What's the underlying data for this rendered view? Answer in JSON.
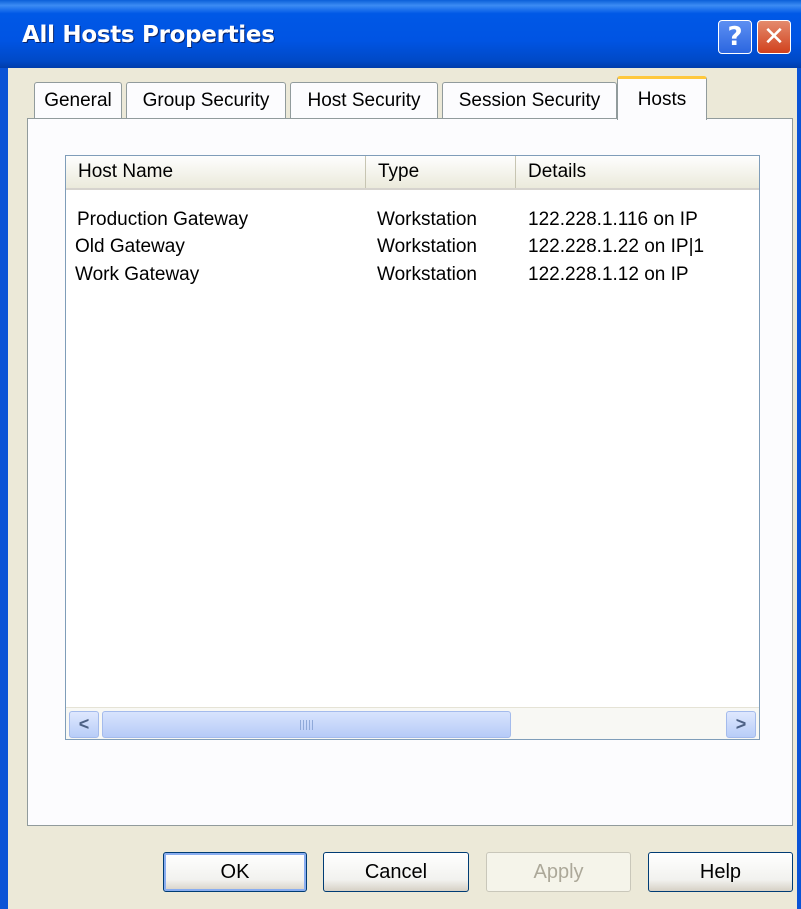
{
  "window": {
    "title": "All Hosts Properties",
    "help_glyph": "?",
    "close_glyph": "✕"
  },
  "tabs": [
    {
      "label": "General",
      "active": false
    },
    {
      "label": "Group Security",
      "active": false
    },
    {
      "label": "Host Security",
      "active": false
    },
    {
      "label": "Session Security",
      "active": false
    },
    {
      "label": "Hosts",
      "active": true
    }
  ],
  "hosts_list": {
    "columns": [
      "Host Name",
      "Type",
      "Details"
    ],
    "rows": [
      {
        "name": "Production Gateway",
        "type": "Workstation",
        "details": "122.228.1.116 on IP"
      },
      {
        "name": "Old Gateway",
        "type": "Workstation",
        "details": "122.228.1.22 on IP|1"
      },
      {
        "name": "Work Gateway",
        "type": "Workstation",
        "details": "122.228.1.12 on IP"
      }
    ]
  },
  "scrollbar": {
    "left_arrow": "<",
    "right_arrow": ">"
  },
  "buttons": {
    "ok": "OK",
    "cancel": "Cancel",
    "apply": "Apply",
    "help": "Help"
  },
  "colors": {
    "title_bar": "#0054e3",
    "active_tab_accent": "#ffc83c",
    "dialog_bg": "#ece9d8"
  }
}
